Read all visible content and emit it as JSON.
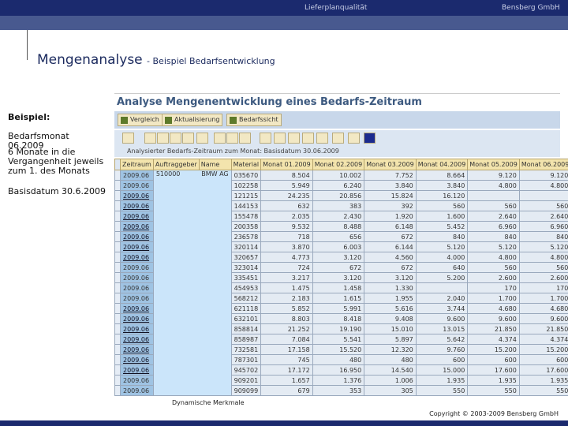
{
  "header": {
    "section": "Lieferplanqualität",
    "company": "Bensberg GmbH"
  },
  "page": {
    "title": "Mengenanalyse",
    "subtitle": "- Beispiel Bedarfsentwicklung"
  },
  "side": {
    "label": "Beispiel:",
    "month": "Bedarfsmonat 06.2009",
    "desc": "6 Monate in die Vergangenheit jeweils zum 1. des Monats",
    "basis": "Basisdatum 30.6.2009"
  },
  "sap": {
    "title": "Analyse Mengenentwicklung eines Bedarfs-Zeitraum",
    "buttons": [
      "Vergleich",
      "Aktualisierung",
      "Bedarfssicht"
    ],
    "info": "Analysierter Bedarfs-Zeitraum zum Monat: Basisdatum 30.06.2009",
    "columns": [
      "Zeitraum",
      "Auftraggeber",
      "Name",
      "Material",
      "Monat 01.2009",
      "Monat 02.2009",
      "Monat 03.2009",
      "Monat 04.2009",
      "Monat 05.2009",
      "Monat 06.2009"
    ],
    "auftraggeber": "510000",
    "name": "BMW AG",
    "rows": [
      {
        "z": "2009.06",
        "m": "035670",
        "v": [
          "8.504",
          "10.002",
          "7.752",
          "8.664",
          "9.120",
          "9.120"
        ]
      },
      {
        "z": "2009.06",
        "m": "102258",
        "v": [
          "5.949",
          "6.240",
          "3.840",
          "3.840",
          "4.800",
          "4.800"
        ]
      },
      {
        "z": "2009.06",
        "m": "121215",
        "v": [
          "24.235",
          "20.856",
          "15.824",
          "16.120",
          "",
          ""
        ]
      },
      {
        "z": "2009.06",
        "m": "144153",
        "v": [
          "632",
          "383",
          "392",
          "560",
          "560",
          "560"
        ]
      },
      {
        "z": "2009.06",
        "m": "155478",
        "v": [
          "2.035",
          "2.430",
          "1.920",
          "1.600",
          "2.640",
          "2.640"
        ]
      },
      {
        "z": "2009.06",
        "m": "200358",
        "v": [
          "9.532",
          "8.488",
          "6.148",
          "5.452",
          "6.960",
          "6.960"
        ]
      },
      {
        "z": "2009.06",
        "m": "236578",
        "v": [
          "718",
          "656",
          "672",
          "840",
          "840",
          "840"
        ]
      },
      {
        "z": "2009.06",
        "m": "320114",
        "v": [
          "3.870",
          "6.003",
          "6.144",
          "5.120",
          "5.120",
          "5.120"
        ]
      },
      {
        "z": "2009.06",
        "m": "320657",
        "v": [
          "4.773",
          "3.120",
          "4.560",
          "4.000",
          "4.800",
          "4.800"
        ]
      },
      {
        "z": "2009.06",
        "m": "323014",
        "v": [
          "724",
          "672",
          "672",
          "640",
          "560",
          "560"
        ]
      },
      {
        "z": "2009.06",
        "m": "335451",
        "v": [
          "3.217",
          "3.120",
          "3.120",
          "5.200",
          "2.600",
          "2.600"
        ]
      },
      {
        "z": "2009.06",
        "m": "454953",
        "v": [
          "1.475",
          "1.458",
          "1.330",
          "",
          "170",
          "170"
        ]
      },
      {
        "z": "2009.06",
        "m": "568212",
        "v": [
          "2.183",
          "1.615",
          "1.955",
          "2.040",
          "1.700",
          "1.700"
        ]
      },
      {
        "z": "2009.06",
        "m": "621118",
        "v": [
          "5.852",
          "5.991",
          "5.616",
          "3.744",
          "4.680",
          "4.680"
        ]
      },
      {
        "z": "2009.06",
        "m": "632101",
        "v": [
          "8.803",
          "8.418",
          "9.408",
          "9.600",
          "9.600",
          "9.600"
        ]
      },
      {
        "z": "2009.06",
        "m": "858814",
        "v": [
          "21.252",
          "19.190",
          "15.010",
          "13.015",
          "21.850",
          "21.850"
        ]
      },
      {
        "z": "2009.06",
        "m": "858987",
        "v": [
          "7.084",
          "5.541",
          "5.897",
          "5.642",
          "4.374",
          "4.374"
        ]
      },
      {
        "z": "2009.06",
        "m": "732581",
        "v": [
          "17.158",
          "15.520",
          "12.320",
          "9.760",
          "15.200",
          "15.200"
        ]
      },
      {
        "z": "2009.06",
        "m": "787301",
        "v": [
          "745",
          "480",
          "480",
          "600",
          "600",
          "600"
        ]
      },
      {
        "z": "2009.06",
        "m": "945702",
        "v": [
          "17.172",
          "16.950",
          "14.540",
          "15.000",
          "17.600",
          "17.600"
        ]
      },
      {
        "z": "2009.06",
        "m": "909201",
        "v": [
          "1.657",
          "1.376",
          "1.006",
          "1.935",
          "1.935",
          "1.935"
        ]
      },
      {
        "z": "2009.06",
        "m": "909099",
        "v": [
          "679",
          "353",
          "305",
          "550",
          "550",
          "550"
        ]
      }
    ]
  },
  "footer": {
    "dynamic": "Dynamische Merkmale",
    "copyright": "Copyright © 2003-2009 Bensberg GmbH"
  }
}
